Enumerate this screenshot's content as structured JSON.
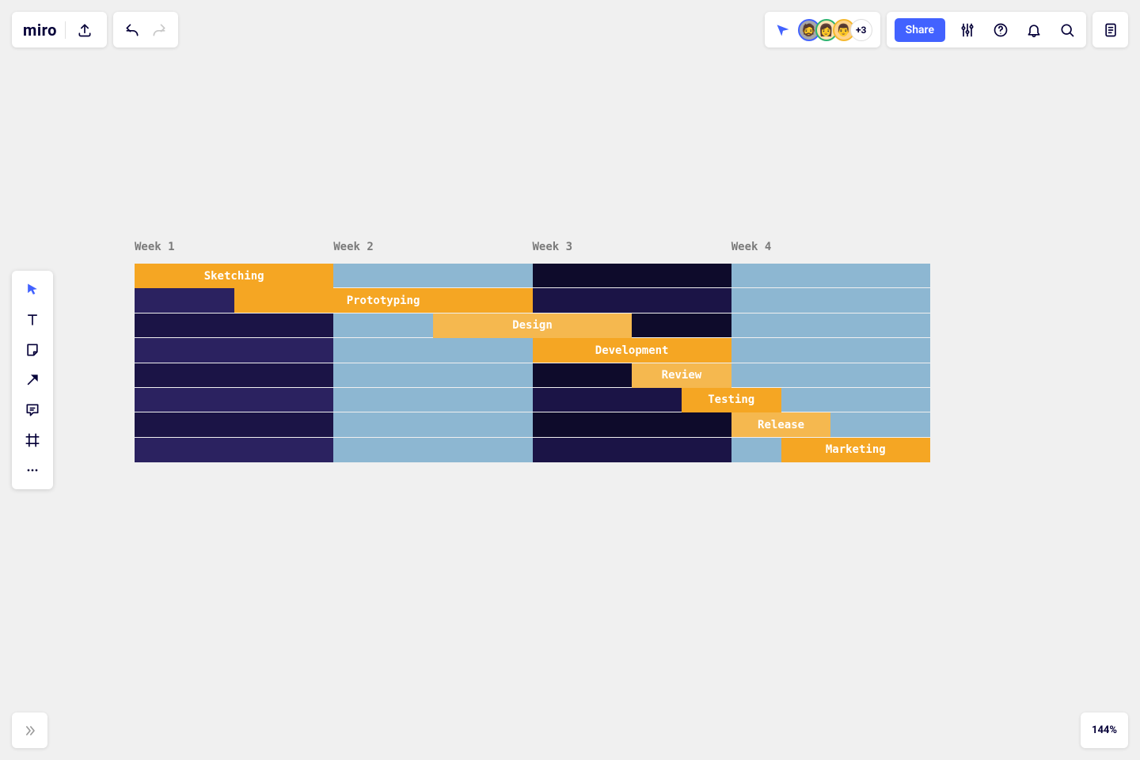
{
  "app": {
    "name": "miro"
  },
  "header": {
    "share_label": "Share",
    "avatar_overflow": "+3"
  },
  "zoom": "144%",
  "chart_data": {
    "type": "gantt",
    "total_units": 16,
    "columns": [
      {
        "label": "Week 1",
        "span": 4,
        "color": "#1b1446",
        "alt_color": "#2b2260"
      },
      {
        "label": "Week 2",
        "span": 4,
        "color": "#8db7d2",
        "alt_color": "#8db7d2"
      },
      {
        "label": "Week 3",
        "span": 4,
        "color": "#0e0b2b",
        "alt_color": "#1b1446"
      },
      {
        "label": "Week 4",
        "span": 4,
        "color": "#8db7d2",
        "alt_color": "#8db7d2"
      }
    ],
    "tasks": [
      {
        "name": "Sketching",
        "start": 0,
        "span": 4,
        "color": "#f5a623"
      },
      {
        "name": "Prototyping",
        "start": 2,
        "span": 6,
        "color": "#f5a623"
      },
      {
        "name": "Design",
        "start": 6,
        "span": 4,
        "color": "#f5b84f"
      },
      {
        "name": "Development",
        "start": 8,
        "span": 4,
        "color": "#f5a623"
      },
      {
        "name": "Review",
        "start": 10,
        "span": 2,
        "color": "#f5b84f"
      },
      {
        "name": "Testing",
        "start": 11,
        "span": 2,
        "color": "#f5a623"
      },
      {
        "name": "Release",
        "start": 12,
        "span": 2,
        "color": "#f5b84f"
      },
      {
        "name": "Marketing",
        "start": 13,
        "span": 3,
        "color": "#f5a623"
      }
    ]
  }
}
